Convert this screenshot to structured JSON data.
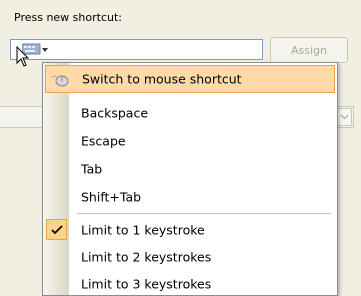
{
  "section_label": "Press new shortcut:",
  "assign_label": "Assign",
  "menu": {
    "items": [
      {
        "label": "Switch to mouse shortcut",
        "highlighted": true,
        "icon": "mouse-icon"
      },
      {
        "label": "Backspace"
      },
      {
        "label": "Escape"
      },
      {
        "label": "Tab"
      },
      {
        "label": "Shift+Tab"
      },
      {
        "label": "Limit to 1 keystroke",
        "checked": true
      },
      {
        "label": "Limit to 2 keystrokes"
      },
      {
        "label": "Limit to 3 keystrokes"
      }
    ]
  }
}
